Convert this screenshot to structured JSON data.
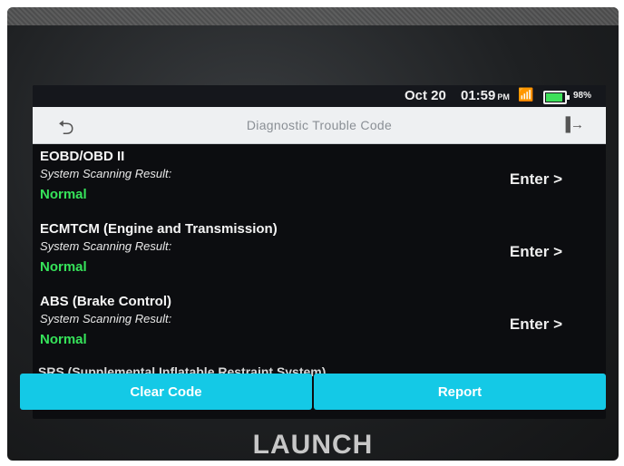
{
  "status_bar": {
    "date": "Oct 20",
    "time": "01:59",
    "ampm": "PM",
    "battery": "98%",
    "battery_level": 0.98,
    "wifi_icon": "wifi-icon",
    "battery_icon": "battery-icon"
  },
  "header": {
    "title": "Diagnostic Trouble Code",
    "back_icon": "back-arrow-icon",
    "exit_icon": "exit-icon"
  },
  "systems": [
    {
      "name": "EOBD/OBD II",
      "label": "System Scanning Result:",
      "result": "Normal",
      "action": "Enter >"
    },
    {
      "name": "ECMTCM (Engine and Transmission)",
      "label": "System Scanning Result:",
      "result": "Normal",
      "action": "Enter >"
    },
    {
      "name": "ABS (Brake Control)",
      "label": "System Scanning Result:",
      "result": "Normal",
      "action": "Enter >"
    },
    {
      "name": "SRS (Supplemental Inflatable Restraint System)"
    }
  ],
  "buttons": {
    "clear_code": "Clear Code",
    "report": "Report"
  },
  "brand": "LAUNCH",
  "colors": {
    "accent": "#14c9e6",
    "normal_status": "#36e35a",
    "header_bg": "#eef0f2"
  }
}
